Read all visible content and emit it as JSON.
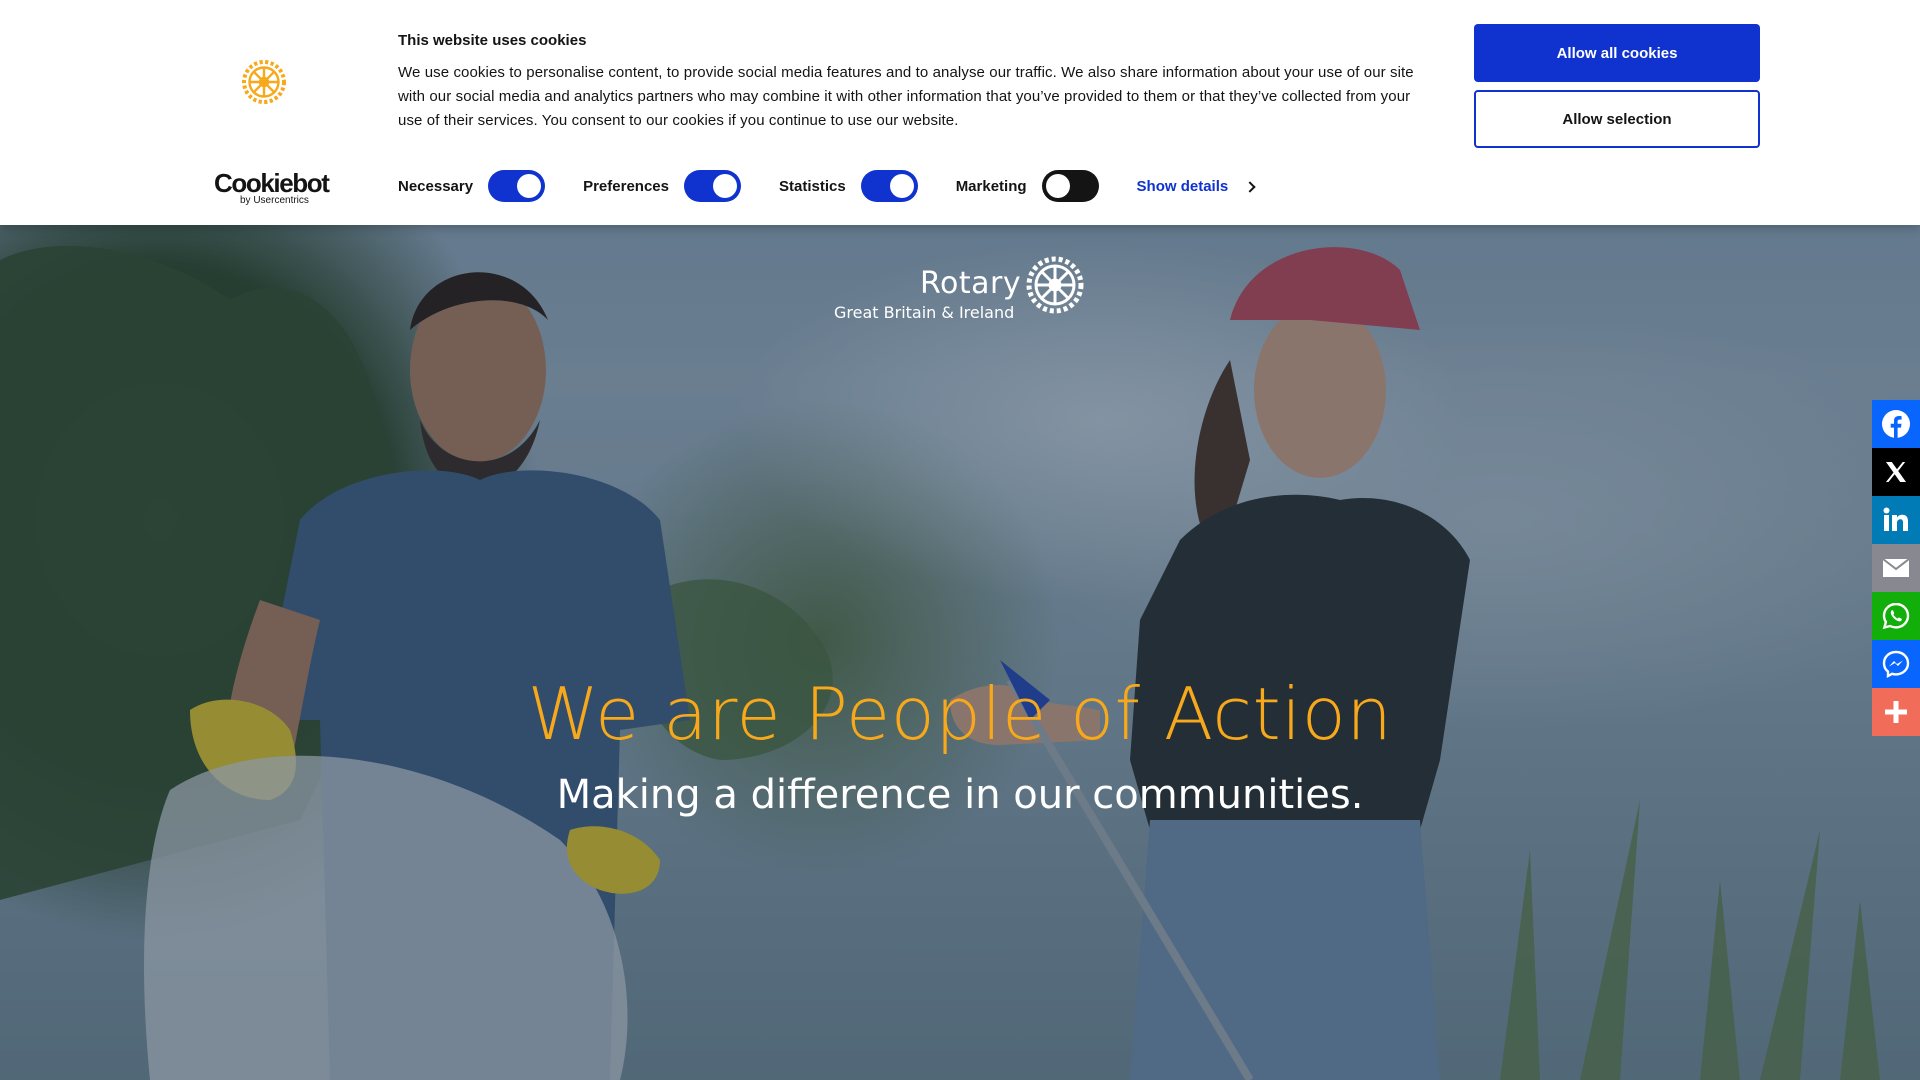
{
  "cookie_banner": {
    "title": "This website uses cookies",
    "text": "We use cookies to personalise content, to provide social media features and to analyse our traffic. We also share information about your use of our site with our social media and analytics partners who may combine it with other information that you’ve provided to them or that they’ve collected from your use of their services. You consent to our cookies if you continue to use our website.",
    "toggles": [
      {
        "label": "Necessary",
        "checked": true
      },
      {
        "label": "Preferences",
        "checked": true
      },
      {
        "label": "Statistics",
        "checked": true
      },
      {
        "label": "Marketing",
        "checked": false
      }
    ],
    "show_details": "Show details",
    "allow_all": "Allow all cookies",
    "allow_selection": "Allow selection",
    "brand_word": "Cookiebot",
    "brand_sub": "by Usercentrics",
    "accent_color": "#1032cf"
  },
  "header": {
    "logo_word": "Rotary",
    "logo_sub": "Great Britain & Ireland"
  },
  "hero": {
    "title": "We are People of Action",
    "subtitle": "Making a difference in our communities.",
    "title_color": "#f7a81b"
  },
  "share_bar": [
    {
      "icon": "facebook-icon",
      "color": "#0866ff"
    },
    {
      "icon": "x-icon",
      "color": "#000000"
    },
    {
      "icon": "linkedin-icon",
      "color": "#007bb5"
    },
    {
      "icon": "email-icon",
      "color": "#888990"
    },
    {
      "icon": "whatsapp-icon",
      "color": "#12af0a"
    },
    {
      "icon": "messenger-icon",
      "color": "#0866ff"
    },
    {
      "icon": "more-share-icon",
      "color": "#f26c5a"
    }
  ]
}
